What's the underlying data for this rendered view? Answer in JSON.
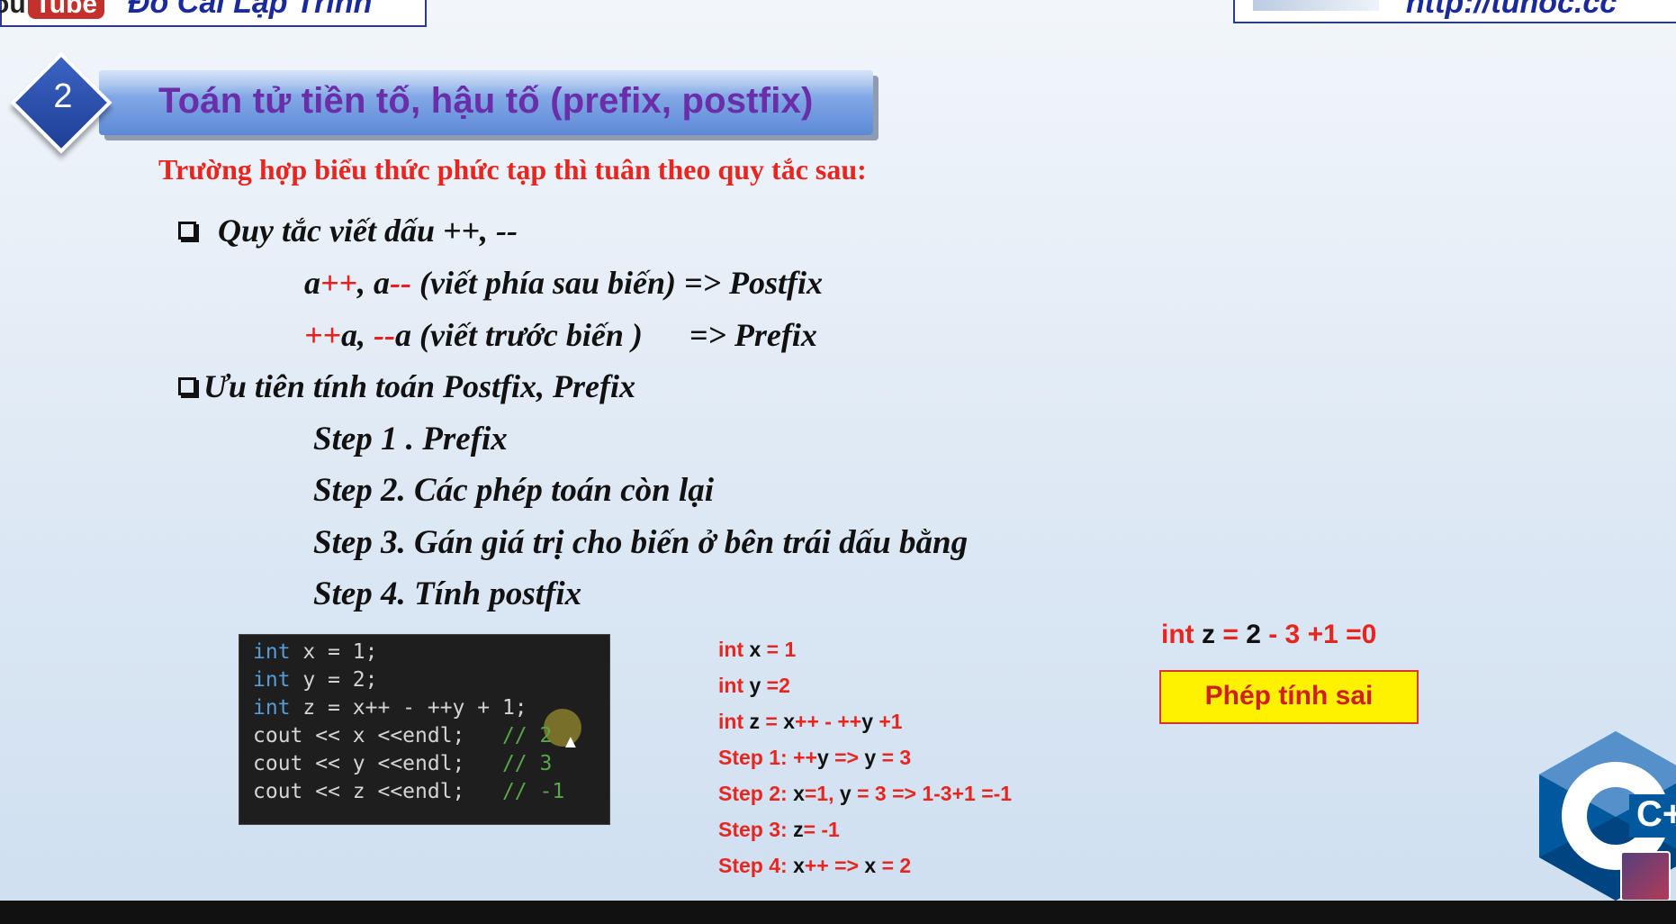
{
  "banner": {
    "yt_left": "ou",
    "yt_tube": "Tube",
    "channel_name": "Đỗ Cải Lập Trình",
    "url": "http://tuhoc.cc"
  },
  "section": {
    "number": "2",
    "title": "Toán tử tiền tố, hậu tố (prefix, postfix)"
  },
  "intro": "Trường hợp biểu thức phức tạp thì tuân theo quy tắc sau:",
  "rules": {
    "heading": "Quy tắc viết dấu ++, --",
    "postfix_a": "a",
    "postfix_pp": "++",
    "postfix_mid": ", a",
    "postfix_mm": "--",
    "postfix_rest": " (viết phía sau biến) => Postfix",
    "prefix_pp": "++",
    "prefix_a": "a, ",
    "prefix_mm": "--",
    "prefix_rest": "a (viết trước biến )",
    "prefix_arrow": "=> Prefix"
  },
  "priority": {
    "heading": "Ưu tiên tính toán Postfix, Prefix",
    "steps": [
      "Step 1 . Prefix",
      "Step 2. Các phép toán còn lại",
      "Step 3. Gán giá trị cho biến ở bên trái dấu bằng",
      "Step 4. Tính postfix"
    ]
  },
  "code": {
    "lines": [
      {
        "kw": "int",
        "rest": " x = 1;",
        "cmt": ""
      },
      {
        "kw": "int",
        "rest": " y = 2;",
        "cmt": ""
      },
      {
        "kw": "int",
        "rest": " z = x++ - ++y + 1;",
        "cmt": ""
      },
      {
        "kw": "",
        "rest": "cout << x <<endl;   ",
        "cmt": "// 2"
      },
      {
        "kw": "",
        "rest": "cout << y <<endl;   ",
        "cmt": "// 3"
      },
      {
        "kw": "",
        "rest": "cout << z <<endl;   ",
        "cmt": "// -1"
      }
    ]
  },
  "explain": {
    "l1_a": "int",
    "l1_b": " x",
    "l1_c": " = 1",
    "l2_a": "int",
    "l2_b": " y",
    "l2_c": " =2",
    "l3_a": "int",
    "l3_b": " z",
    "l3_c": " = ",
    "l3_d": "x",
    "l3_e": "++ - ++",
    "l3_f": "y",
    "l3_g": " +1",
    "l4_a": "Step 1: ++",
    "l4_b": "y",
    "l4_c": " => ",
    "l4_d": "y",
    "l4_e": " = 3",
    "l5_a": "Step 2: ",
    "l5_b": "x",
    "l5_c": "=1, ",
    "l5_d": "y",
    "l5_e": " = 3 => 1-3+1 =-1",
    "l6_a": "Step 3: ",
    "l6_b": "z",
    "l6_c": "= -1",
    "l7_a": "Step 4: ",
    "l7_b": "x",
    "l7_c": "++ => ",
    "l7_d": "x",
    "l7_e": " = 2"
  },
  "z_eq": {
    "a": "int",
    "b": " z",
    "c": " = ",
    "d": "2",
    "e": " - 3 +1 =0"
  },
  "wrong_label": "Phép tính sai",
  "logo": {
    "text": "C++"
  },
  "colors": {
    "accent_red": "#e8251f",
    "title_purple": "#6a2ea8",
    "header_blue": "#5d89d6",
    "highlight_yellow": "#fff200"
  }
}
